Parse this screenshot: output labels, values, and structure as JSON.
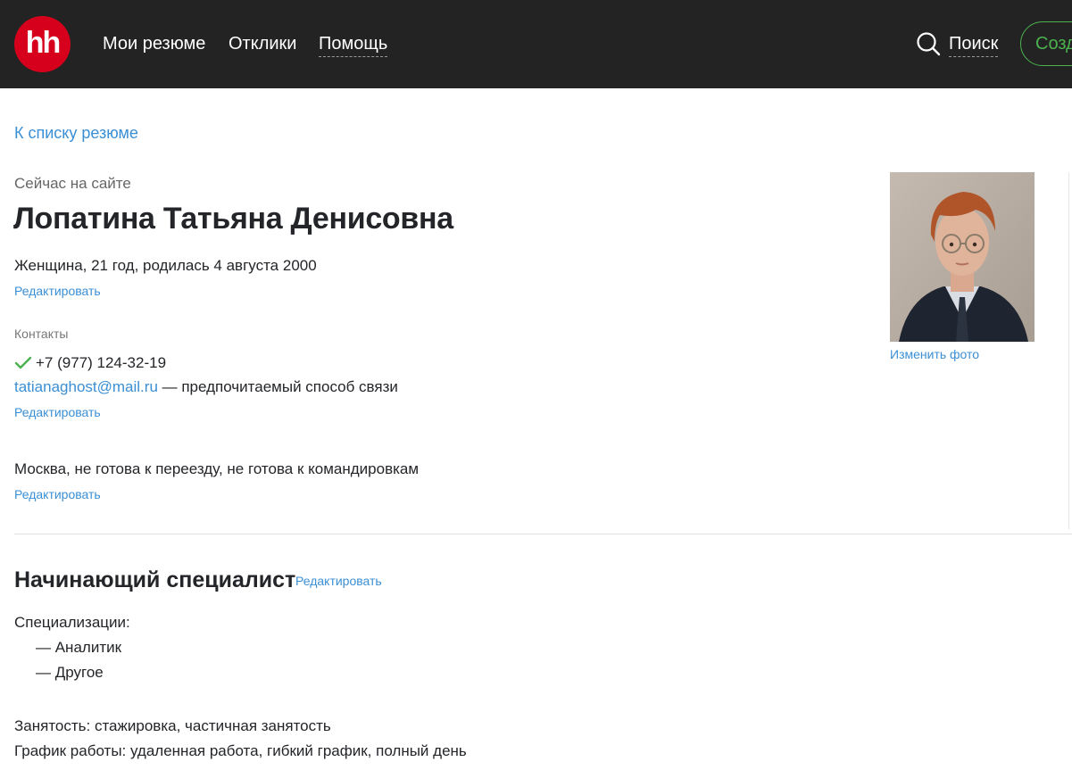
{
  "header": {
    "logo_text": "hh",
    "nav": [
      {
        "label": "Мои резюме"
      },
      {
        "label": "Отклики"
      },
      {
        "label": "Помощь"
      }
    ],
    "search_label": "Поиск",
    "create_label": "Создать резюме"
  },
  "back_link": "К списку резюме",
  "profile": {
    "status": "Сейчас на сайте",
    "name": "Лопатина Татьяна Денисовна",
    "demographics": "Женщина, 21 год, родилась 4 августа 2000",
    "edit_label": "Редактировать",
    "change_photo": "Изменить фото"
  },
  "contacts": {
    "caption": "Контакты",
    "phone": "+7 (977) 124-32-19",
    "email": "tatianaghost@mail.ru",
    "email_note": " — предпочитаемый способ связи"
  },
  "location": {
    "text": "Москва, не готова к переезду, не готова к командировкам"
  },
  "position": {
    "title": "Начинающий специалист",
    "specializations_label": "Специализации:",
    "specializations": [
      "— Аналитик",
      "— Другое"
    ],
    "employment": "Занятость: стажировка, частичная занятость",
    "schedule": "График работы: удаленная работа, гибкий график, полный день"
  },
  "colors": {
    "header_bg": "#232323",
    "logo_red": "#d6001c",
    "link_blue": "#3b8fd4",
    "create_green": "#4bb24e",
    "check_green": "#4bb24e"
  }
}
